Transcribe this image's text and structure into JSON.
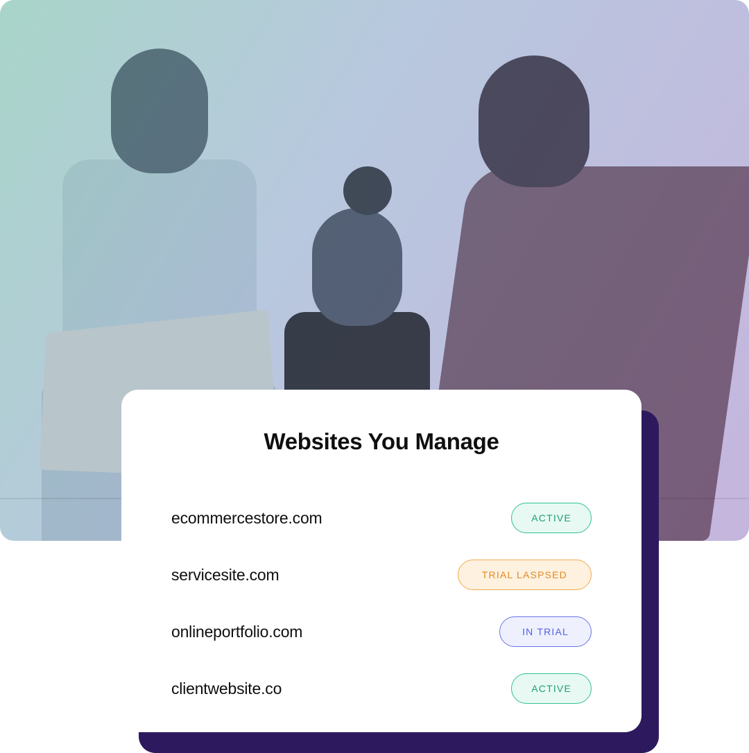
{
  "card": {
    "title": "Websites You Manage",
    "sites": [
      {
        "name": "ecommercestore.com",
        "status": "ACTIVE",
        "statusClass": "status-active"
      },
      {
        "name": "servicesite.com",
        "status": "TRIAL LASPSED",
        "statusClass": "status-trial-lapsed"
      },
      {
        "name": "onlineportfolio.com",
        "status": "IN TRIAL",
        "statusClass": "status-in-trial"
      },
      {
        "name": "clientwebsite.co",
        "status": "ACTIVE",
        "statusClass": "status-active"
      }
    ]
  }
}
